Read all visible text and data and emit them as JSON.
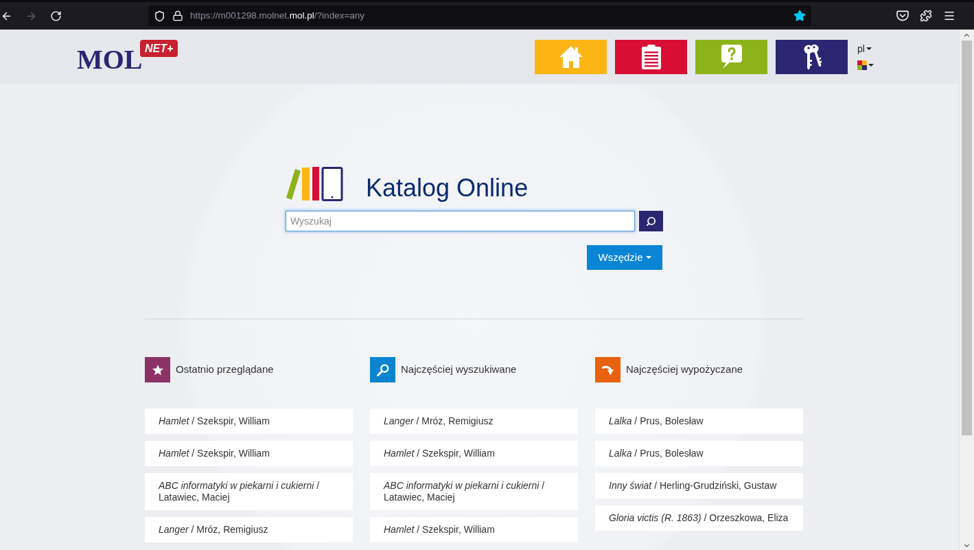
{
  "browser": {
    "nav_buttons": [
      {
        "kind": "back",
        "disabled": false
      },
      {
        "kind": "forward",
        "disabled": true
      },
      {
        "kind": "reload",
        "disabled": false
      }
    ],
    "url": "https://m001298.molnet.**mol.pl**/?index=any",
    "bookmarked": true
  },
  "header": {
    "logo": {
      "text": "MOL",
      "badge": "NET+"
    },
    "nav_buttons": [
      {
        "kind": "home",
        "color": "#fdb515"
      },
      {
        "kind": "clipboard",
        "color": "#d80e34"
      },
      {
        "kind": "help",
        "color": "#8db31b"
      },
      {
        "kind": "login",
        "color": "#2b2671"
      }
    ],
    "language": "pl"
  },
  "search": {
    "title": "Katalog Online",
    "placeholder": "Wyszukaj",
    "scope": "Wszędzie"
  },
  "sections": [
    {
      "kind": "recent",
      "title": "Ostatnio przeglądane",
      "color": "#8b3366",
      "items": [
        "*Hamlet* / Szekspir, William",
        "*Hamlet* / Szekspir, William",
        "*ABC informatyki w piekarni i cukierni* / Latawiec, Maciej",
        "*Langer* / Mróz, Remigiusz"
      ]
    },
    {
      "kind": "searched",
      "title": "Najczęściej wyszukiwane",
      "color": "#0b84cf",
      "items": [
        "*Langer* / Mróz, Remigiusz",
        "*Hamlet* / Szekspir, William",
        "*ABC informatyki w piekarni i cukierni* / Latawiec, Maciej",
        "*Hamlet* / Szekspir, William"
      ]
    },
    {
      "kind": "borrowed",
      "title": "Najczęściej wypożyczane",
      "color": "#e8610f",
      "items": [
        "*Lalka* / Prus, Bolesław",
        "*Lalka* / Prus, Bolesław",
        "*Inny świat* / Herling-Grudziński, Gustaw",
        "*Gloria victis (R. 1863)* / Orzeszkowa, Eliza"
      ]
    }
  ]
}
